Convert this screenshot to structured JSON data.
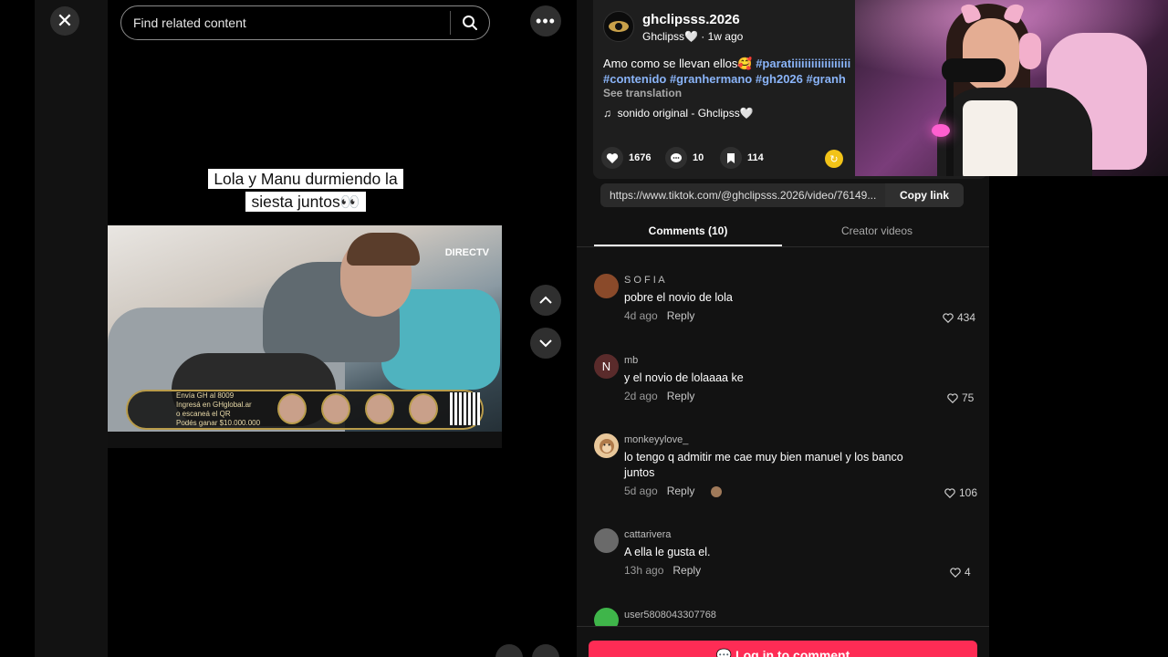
{
  "search": {
    "placeholder": "Find related content"
  },
  "video": {
    "caption": "Lola y Manu durmiendo la siesta juntos👀",
    "channel_logo": "DIRECTV",
    "banner_line1": "Envía GH al 8009",
    "banner_line2": "Ingresá en GHglobal.ar",
    "banner_line3": "o escaneá el QR",
    "banner_line4": "Podés ganar $10.000.000"
  },
  "post": {
    "author": "ghclipsss.2026",
    "author_sub": "Ghclipss🤍 · 1w ago",
    "desc_line1_text": "Amo como se llevan ellos🥰 ",
    "desc_line1_tag": "#paratiiiiiiiiiiiiiiiiii",
    "desc_line2": "#contenido #granhermano #gh2026 #granh",
    "see_translation": "See translation",
    "sound": "sonido original - Ghclipss🤍",
    "likes": "1676",
    "comments": "10",
    "saves": "114"
  },
  "link": {
    "url": "https://www.tiktok.com/@ghclipsss.2026/video/76149...",
    "copy_label": "Copy link"
  },
  "tabs": {
    "comments": "Comments (10)",
    "creator": "Creator videos"
  },
  "comments": [
    {
      "user": "S O F I A",
      "text": "pobre el novio de lola",
      "time": "4d ago",
      "reply": "Reply",
      "likes": "434",
      "avatar_color": "#8a4a2a"
    },
    {
      "user": "mb",
      "text": "y el novio de lolaaaa ke",
      "time": "2d ago",
      "reply": "Reply",
      "likes": "75",
      "avatar_letter": "N",
      "avatar_color": "#5a2b2b"
    },
    {
      "user": "monkeyylove_",
      "text": "lo tengo q admitir me cae muy bien manuel y los banco juntos",
      "time": "5d ago",
      "reply": "Reply",
      "likes": "106",
      "avatar_color": "#e8c79a"
    },
    {
      "user": "cattarivera",
      "text": "A ella le gusta el.",
      "time": "13h ago",
      "reply": "Reply",
      "likes": "4",
      "avatar_color": "#6a6a6a"
    },
    {
      "user": "user5808043307768",
      "avatar_color": "#3fb54a"
    }
  ],
  "login": {
    "label": "Log in to comment"
  },
  "colors": {
    "accent": "#fe2c55",
    "tag": "#8ab4f8",
    "coin": "#f2c318"
  }
}
